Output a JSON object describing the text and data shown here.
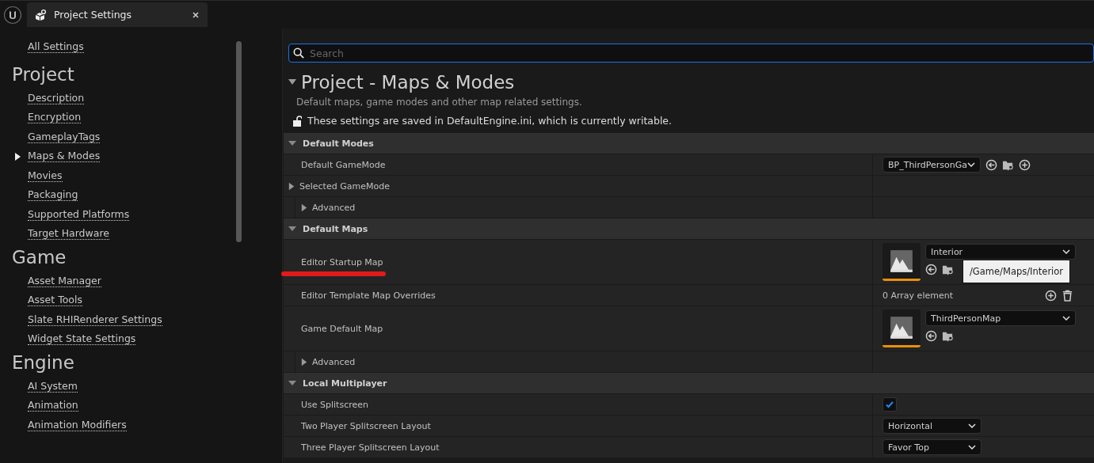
{
  "tab": {
    "title": "Project Settings"
  },
  "sidebar": {
    "all_settings": "All Settings",
    "sections": [
      {
        "heading": "Project",
        "items": [
          {
            "label": "Description",
            "selected": false
          },
          {
            "label": "Encryption",
            "selected": false
          },
          {
            "label": "GameplayTags",
            "selected": false
          },
          {
            "label": "Maps & Modes",
            "selected": true
          },
          {
            "label": "Movies",
            "selected": false
          },
          {
            "label": "Packaging",
            "selected": false
          },
          {
            "label": "Supported Platforms",
            "selected": false
          },
          {
            "label": "Target Hardware",
            "selected": false
          }
        ]
      },
      {
        "heading": "Game",
        "items": [
          {
            "label": "Asset Manager",
            "selected": false
          },
          {
            "label": "Asset Tools",
            "selected": false
          },
          {
            "label": "Slate RHIRenderer Settings",
            "selected": false
          },
          {
            "label": "Widget State Settings",
            "selected": false
          }
        ]
      },
      {
        "heading": "Engine",
        "items": [
          {
            "label": "AI System",
            "selected": false
          },
          {
            "label": "Animation",
            "selected": false
          },
          {
            "label": "Animation Modifiers",
            "selected": false
          }
        ]
      }
    ]
  },
  "search": {
    "placeholder": "Search"
  },
  "header": {
    "title": "Project - Maps & Modes",
    "expanded": true,
    "description": "Default maps, game modes and other map related settings.",
    "lock_note": "These settings are saved in DefaultEngine.ini, which is currently writable."
  },
  "sections": [
    {
      "label": "Default Modes",
      "expanded": true,
      "rows": [
        {
          "kind": "property",
          "label": "Default GameMode",
          "value": {
            "kind": "combo",
            "text": "BP_ThirdPersonGa",
            "buttons": [
              {
                "kind": "use"
              },
              {
                "kind": "browse"
              },
              {
                "kind": "add"
              }
            ]
          }
        },
        {
          "kind": "group",
          "label": "Selected GameMode",
          "expanded": false
        },
        {
          "kind": "subgroup",
          "label": "Advanced",
          "expanded": false
        }
      ]
    },
    {
      "label": "Default Maps",
      "expanded": true,
      "rows": [
        {
          "kind": "property",
          "label": "Editor Startup Map",
          "underlined": true,
          "value": {
            "kind": "asset",
            "text": "Interior",
            "buttons": [
              {
                "kind": "use"
              },
              {
                "kind": "browse"
              }
            ],
            "tooltip": "/Game/Maps/Interior"
          }
        },
        {
          "kind": "property",
          "label": "Editor Template Map Overrides",
          "value": {
            "kind": "array",
            "text": "0 Array element",
            "buttons": [
              {
                "kind": "add"
              },
              {
                "kind": "delete"
              }
            ]
          }
        },
        {
          "kind": "property",
          "label": "Game Default Map",
          "value": {
            "kind": "asset",
            "text": "ThirdPersonMap",
            "buttons": [
              {
                "kind": "use"
              },
              {
                "kind": "browse"
              }
            ]
          }
        },
        {
          "kind": "subgroup",
          "label": "Advanced",
          "expanded": false
        }
      ]
    },
    {
      "label": "Local Multiplayer",
      "expanded": true,
      "rows": [
        {
          "kind": "property",
          "label": "Use Splitscreen",
          "value": {
            "kind": "checkbox",
            "checked": true
          }
        },
        {
          "kind": "property",
          "label": "Two Player Splitscreen Layout",
          "value": {
            "kind": "enum",
            "text": "Horizontal"
          }
        },
        {
          "kind": "property",
          "label": "Three Player Splitscreen Layout",
          "value": {
            "kind": "enum",
            "text": "Favor Top"
          }
        }
      ]
    }
  ]
}
